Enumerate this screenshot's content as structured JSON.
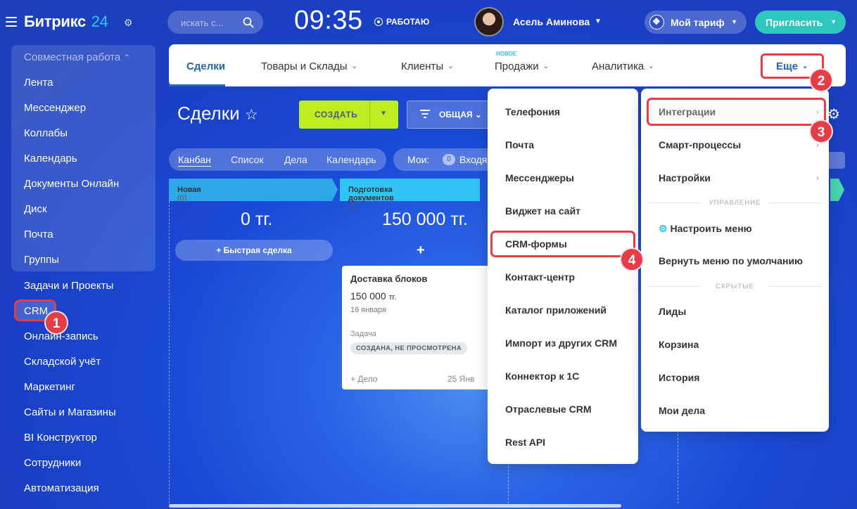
{
  "header": {
    "logo": "Битрикс",
    "logo_num": "24",
    "search_placeholder": "искать с...",
    "clock": "09:35",
    "work_status": "РАБОТАЮ",
    "user_name": "Асель Аминова",
    "plan_label": "Мой тариф",
    "invite_label": "Пригласить"
  },
  "sidebar": {
    "group_title": "Совместная работа",
    "group_items": [
      "Лента",
      "Мессенджер",
      "Коллабы",
      "Календарь",
      "Документы Онлайн",
      "Диск",
      "Почта",
      "Группы"
    ],
    "items": [
      "Задачи и Проекты",
      "CRM",
      "Онлайн-запись",
      "Складской учёт",
      "Маркетинг",
      "Сайты и Магазины",
      "BI Конструктор",
      "Сотрудники",
      "Автоматизация"
    ]
  },
  "tabs": {
    "items": [
      "Сделки",
      "Товары и Склады",
      "Клиенты",
      "Продажи",
      "Аналитика"
    ],
    "new_label": "НОВОЕ",
    "more": "Еще"
  },
  "page": {
    "title": "Сделки",
    "create": "СОЗДАТЬ",
    "filter": "ОБЩАЯ",
    "views": [
      "Канбан",
      "Список",
      "Дела",
      "Календарь"
    ],
    "mine": "Мои:",
    "mine_count": "0",
    "incoming": "Входя"
  },
  "columns": [
    {
      "name": "Новая",
      "count": "(0)",
      "sum": "0 тг.",
      "quick": "Быстрая сделка"
    },
    {
      "name": "Подготовка документов",
      "count": "(1)",
      "sum": "150 000 тг."
    }
  ],
  "card": {
    "title": "Доставка блоков",
    "amount": "150 000",
    "currency": "тг.",
    "date": "16 января",
    "task_label": "Задача",
    "status": "СОЗДАНА, НЕ ПРОСМОТРЕНА",
    "add": "+ Дело",
    "due": "25 Янв"
  },
  "menu1": [
    "Телефония",
    "Почта",
    "Мессенджеры",
    "Виджет на сайт",
    "CRM-формы",
    "Контакт-центр",
    "Каталог приложений",
    "Импорт из других CRM",
    "Коннектор к 1С",
    "Отраслевые CRM",
    "Rest API"
  ],
  "menu2": {
    "top": [
      "Интеграции",
      "Смарт-процессы",
      "Настройки"
    ],
    "section_manage": "УПРАВЛЕНИЕ",
    "configure": "Настроить меню",
    "reset": "Вернуть меню по умолчанию",
    "section_hidden": "СКРЫТЫЕ",
    "hidden": [
      "Лиды",
      "Корзина",
      "История",
      "Мои дела"
    ]
  },
  "steps": [
    "1",
    "2",
    "3",
    "4"
  ],
  "colors": {
    "accent": "#2066b0",
    "highlight": "#e63c47",
    "create_button": "#bbed21",
    "invite_button": "#2fc6c0"
  }
}
